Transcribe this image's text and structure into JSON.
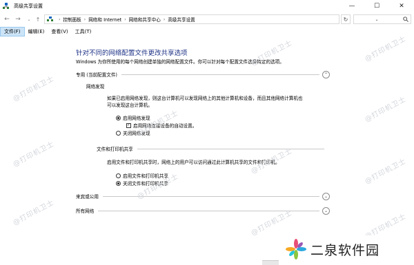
{
  "window": {
    "title": "高级共享设置",
    "min_glyph": "—",
    "max_glyph": "☐",
    "close_glyph": "✕"
  },
  "address": {
    "crumbs": [
      "控制面板",
      "网络和 Internet",
      "网络和共享中心",
      "高级共享设置"
    ],
    "separator": "›"
  },
  "menu": {
    "items": [
      "文件(F)",
      "编辑(E)",
      "查看(V)",
      "工具(T)"
    ]
  },
  "content": {
    "heading": "针对不同的网络配置文件更改共享选项",
    "description": "Windows 为你所使用的每个网络创建单独的网络配置文件。你可以针对每个配置文件选择特定的选项。",
    "private_profile": {
      "label": "专用 (当前配置文件)",
      "network_discovery": {
        "label": "网络发现",
        "para_line1": "如果已启用网络发现，则这台计算机可以发现网络上的其他计算机和设备，而且其他网络计算机也",
        "para_line2": "可以发现这台计算机。",
        "opt_on": "启用网络发现",
        "opt_auto": "启用网络连接设备的自动设置。",
        "opt_off": "关闭网络发现",
        "selected": "on",
        "auto_checked": true
      },
      "file_printer_sharing": {
        "label": "文件和打印机共享",
        "para": "启用文件和打印机共享时，网络上的用户可以访问通过此计算机共享的文件和打印机。",
        "opt_on": "启用文件和打印机共享",
        "opt_off": "关闭文件和打印机共享",
        "selected": "off"
      }
    },
    "guest_public": {
      "label": "来宾或公用"
    },
    "all_networks": {
      "label": "所有网络"
    }
  },
  "watermark": "@打印机卫士",
  "logo": {
    "text": "二泉软件园"
  },
  "icons": {
    "app": "network-icon",
    "search": "search-icon",
    "expand": "chevron-up-icon",
    "collapse": "chevron-down-icon"
  }
}
